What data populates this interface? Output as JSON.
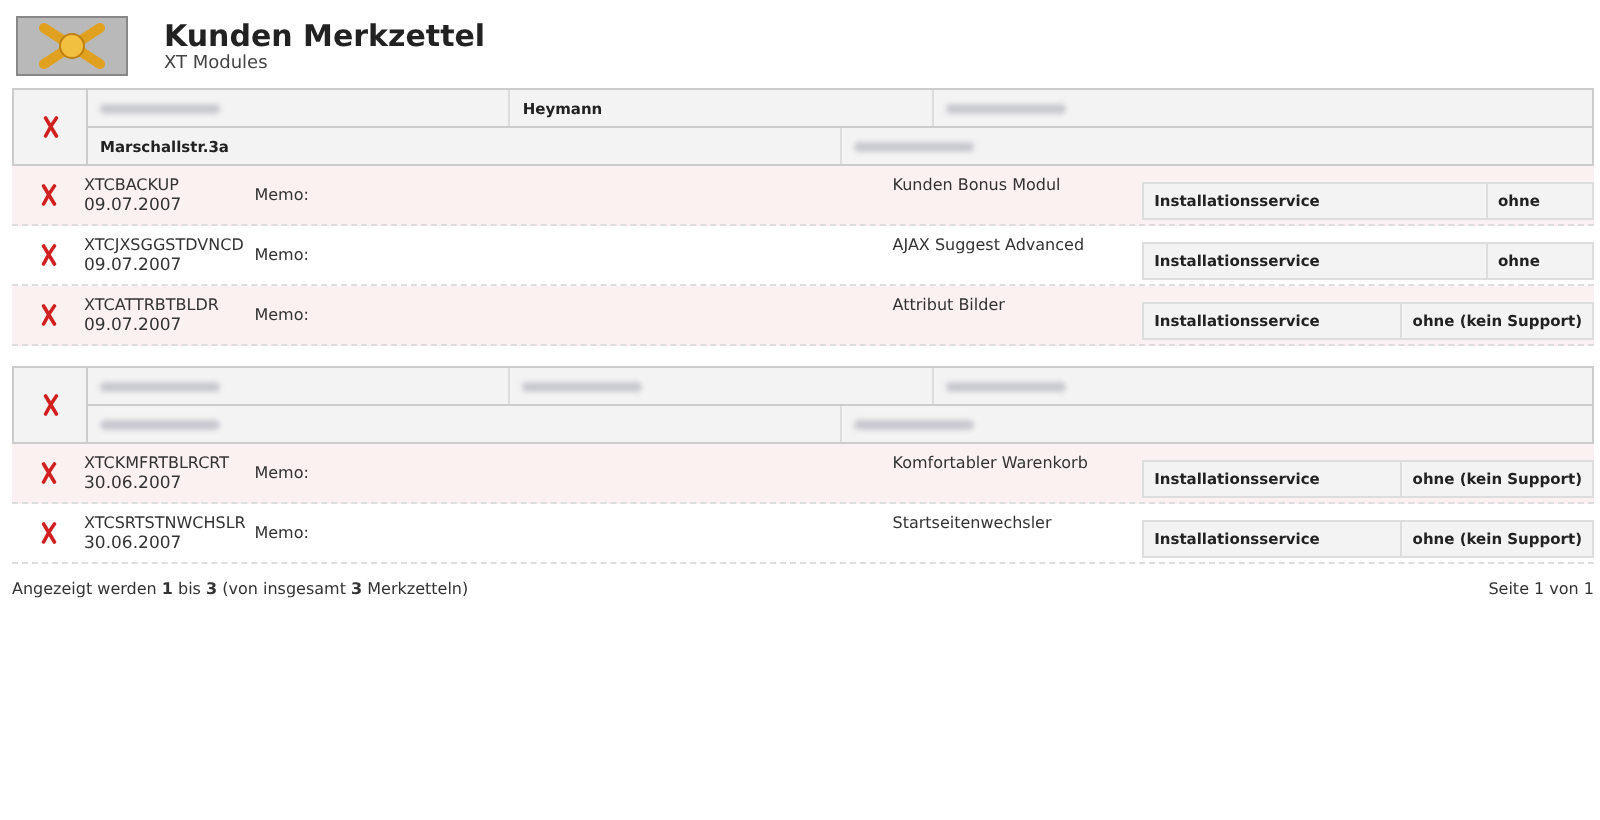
{
  "header": {
    "title": "Kunden Merkzettel",
    "subtitle": "XT Modules"
  },
  "groups": [
    {
      "customer_rows": [
        [
          {
            "kind": "redacted"
          },
          {
            "kind": "text",
            "text": "Heymann"
          },
          {
            "kind": "redacted"
          }
        ],
        [
          {
            "kind": "text",
            "text": "Marschallstr.3a"
          },
          {
            "kind": "redacted"
          }
        ]
      ],
      "items": [
        {
          "code": "XTCBACKUP",
          "date": "09.07.2007",
          "memo": "Memo:",
          "product": "Kunden Bonus Modul",
          "service": "Installationsservice",
          "support": "ohne"
        },
        {
          "code": "XTCJXSGGSTDVNCD",
          "date": "09.07.2007",
          "memo": "Memo:",
          "product": "AJAX Suggest Advanced",
          "service": "Installationsservice",
          "support": "ohne"
        },
        {
          "code": "XTCATTRBTBLDR",
          "date": "09.07.2007",
          "memo": "Memo:",
          "product": "Attribut Bilder",
          "service": "Installationsservice",
          "support": "ohne (kein Support)"
        }
      ]
    },
    {
      "customer_rows": [
        [
          {
            "kind": "redacted"
          },
          {
            "kind": "redacted"
          },
          {
            "kind": "redacted"
          }
        ],
        [
          {
            "kind": "redacted"
          },
          {
            "kind": "redacted"
          }
        ]
      ],
      "items": [
        {
          "code": "XTCKMFRTBLRCRT",
          "date": "30.06.2007",
          "memo": "Memo:",
          "product": "Komfortabler Warenkorb",
          "service": "Installationsservice",
          "support": "ohne (kein Support)"
        },
        {
          "code": "XTCSRTSTNWCHSLR",
          "date": "30.06.2007",
          "memo": "Memo:",
          "product": "Startseitenwechsler",
          "service": "Installationsservice",
          "support": "ohne (kein Support)"
        }
      ]
    }
  ],
  "footer": {
    "summary": "Angezeigt werden **1** bis **3** (von insgesamt **3** Merkzetteln)",
    "page": "Seite 1 von 1"
  }
}
